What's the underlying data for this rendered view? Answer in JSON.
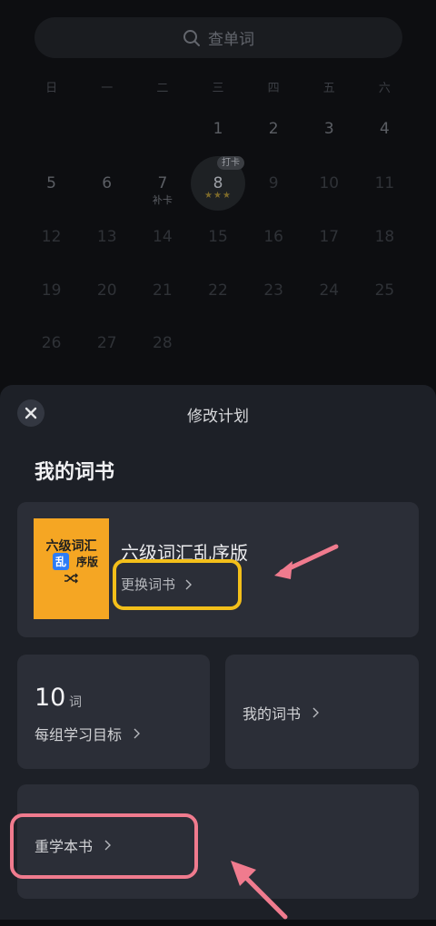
{
  "search": {
    "placeholder": "查单词",
    "icon": "search-icon"
  },
  "calendar": {
    "weekdays": [
      "日",
      "一",
      "二",
      "三",
      "四",
      "五",
      "六"
    ],
    "rows": [
      [
        "",
        "",
        "",
        "1",
        "2",
        "3",
        "4"
      ],
      [
        "5",
        "6",
        "7",
        "8",
        "9",
        "10",
        "11"
      ],
      [
        "12",
        "13",
        "14",
        "15",
        "16",
        "17",
        "18"
      ],
      [
        "19",
        "20",
        "21",
        "22",
        "23",
        "24",
        "25"
      ],
      [
        "26",
        "27",
        "28",
        "",
        "",
        "",
        ""
      ]
    ],
    "makeup_label": "补卡",
    "punch_label": "打卡",
    "today": "8",
    "stars": "★★★"
  },
  "sheet": {
    "title": "修改计划",
    "close_icon": "close-icon",
    "section_title": "我的词书",
    "book": {
      "cover_line1": "六级词汇",
      "cover_badge": "乱",
      "cover_line2": "序版",
      "name": "六级词汇乱序版",
      "change_label": "更换词书"
    },
    "goal": {
      "value": "10",
      "unit": "词",
      "label": "每组学习目标"
    },
    "my_books_label": "我的词书",
    "relearn_label": "重学本书"
  },
  "colors": {
    "highlight_yellow": "#f3bf1a",
    "highlight_pink": "#f07b8e",
    "card_bg": "#2b2e37",
    "cover_bg": "#f5a623"
  }
}
